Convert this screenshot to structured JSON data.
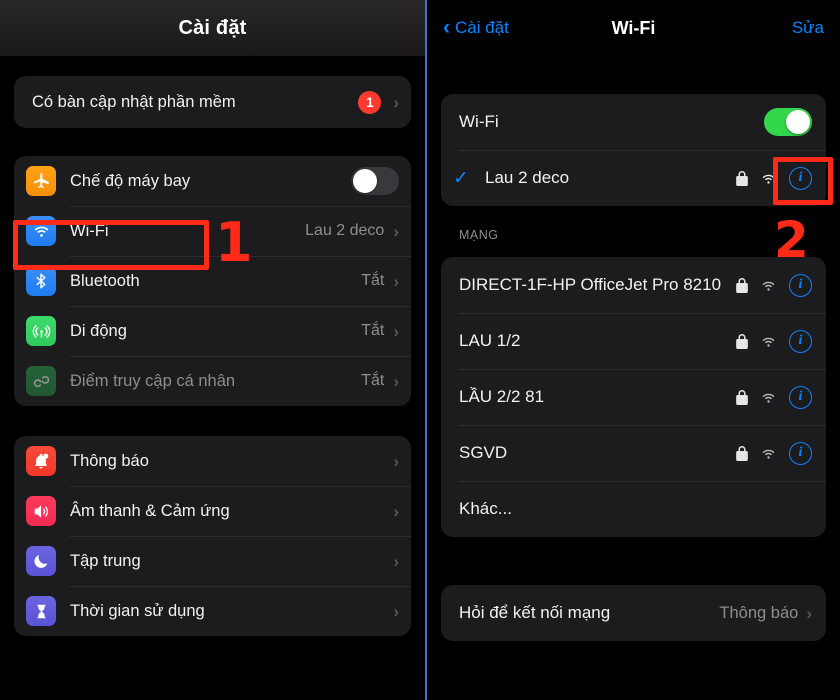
{
  "settings_panel": {
    "header_title": "Cài đặt",
    "update_row": {
      "label": "Có bàn cập nhật phần mềm",
      "badge": "1",
      "chevron": "›"
    },
    "group_connectivity": [
      {
        "label": "Chế độ máy bay",
        "icon": "airplane-icon",
        "control": "toggle-off"
      },
      {
        "label": "Wi-Fi",
        "icon": "wifi-icon",
        "value": "Lau 2 deco",
        "chevron": "›"
      },
      {
        "label": "Bluetooth",
        "icon": "bluetooth-icon",
        "value": "Tắt",
        "chevron": "›"
      },
      {
        "label": "Di động",
        "icon": "cellular-icon",
        "value": "Tắt",
        "chevron": "›"
      },
      {
        "label": "Điểm truy cập cá nhân",
        "icon": "hotspot-icon",
        "value": "Tắt",
        "chevron": "›",
        "dimmed": true
      }
    ],
    "group_system": [
      {
        "label": "Thông báo",
        "icon": "bell-icon",
        "chevron": "›"
      },
      {
        "label": "Âm thanh & Cảm ứng",
        "icon": "speaker-icon",
        "chevron": "›"
      },
      {
        "label": "Tập trung",
        "icon": "moon-icon",
        "chevron": "›"
      },
      {
        "label": "Thời gian sử dụng",
        "icon": "hourglass-icon",
        "chevron": "›"
      }
    ]
  },
  "wifi_panel": {
    "back_label": "Cài đặt",
    "back_chevron": "‹",
    "title": "Wi-Fi",
    "edit_label": "Sửa",
    "wifi_toggle_label": "Wi-Fi",
    "wifi_toggle_state": "on",
    "connected_network": {
      "name": "Lau 2 deco",
      "checkmark": "✓",
      "lock": "lock-icon",
      "signal": "wifi-signal-icon",
      "info": "i"
    },
    "networks_section_label": "MẠNG",
    "networks": [
      {
        "name": "DIRECT-1F-HP OfficeJet Pro 8210",
        "lock": true,
        "signal": true,
        "info": "i"
      },
      {
        "name": "LAU 1/2",
        "lock": true,
        "signal": true,
        "info": "i"
      },
      {
        "name": "LẦU 2/2 81",
        "lock": true,
        "signal": true,
        "info": "i"
      },
      {
        "name": "SGVD",
        "lock": true,
        "signal": true,
        "info": "i"
      },
      {
        "name": "Khác...",
        "lock": false,
        "signal": false,
        "info": null
      }
    ],
    "ask_to_join": {
      "label": "Hỏi để kết nối mạng",
      "value": "Thông báo",
      "chevron": "›"
    }
  },
  "annotations": {
    "step_one": "1",
    "step_two": "2",
    "accent_color": "#ff2a17"
  },
  "colors": {
    "accent_blue": "#0a84ff",
    "toggle_on_green": "#32d74b",
    "badge_red": "#ff3b30",
    "card_bg": "#1c1c1e",
    "page_bg": "#000000"
  }
}
